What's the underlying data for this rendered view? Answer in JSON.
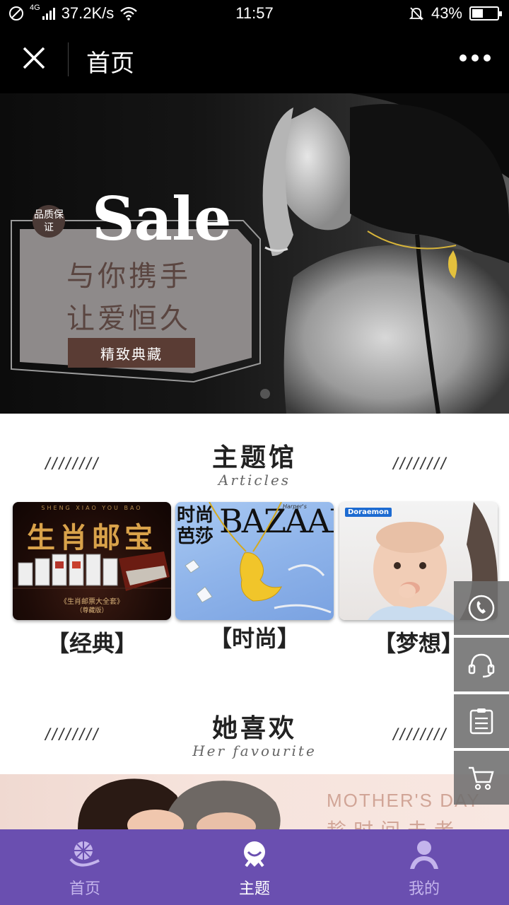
{
  "status_bar": {
    "network": "4G",
    "speed": "37.2K/s",
    "time": "11:57",
    "battery": "43%",
    "battery_level": 0.43
  },
  "header": {
    "title": "首页",
    "close_icon": "close-icon",
    "more_icon": "more-icon"
  },
  "banner": {
    "sale_text": "Sale",
    "badge_text": "品质保证",
    "line1": "与你携手",
    "line2": "让爱恒久",
    "button_label": "精致典藏"
  },
  "section1": {
    "title": "主题馆",
    "subtitle": "Articles",
    "slashes": "////////",
    "cards": [
      {
        "caption": "【经典】",
        "image_top": "SHENG XIAO YOU BAO",
        "image_title": "生肖邮宝",
        "image_sub": "《生肖邮票大全套》",
        "image_sub2": "（尊藏版）"
      },
      {
        "caption": "【时尚】",
        "image_title": "BAZAAR",
        "image_cn": "时尚芭莎",
        "image_small": "Harper's"
      },
      {
        "caption": "【梦想】",
        "image_tag": "Doraemon"
      }
    ]
  },
  "section2": {
    "title": "她喜欢",
    "subtitle": "Her favourite",
    "slashes": "////////",
    "banner_text": "MOTHER'S DAY",
    "banner_cn": "趁时间未老"
  },
  "side_buttons": [
    "phone-icon",
    "headset-icon",
    "clipboard-icon",
    "cart-icon"
  ],
  "tabbar": {
    "tabs": [
      {
        "label": "首页",
        "icon": "home-swirl-icon",
        "active": false
      },
      {
        "label": "主题",
        "icon": "theme-icon",
        "active": true
      },
      {
        "label": "我的",
        "icon": "user-icon",
        "active": false
      }
    ]
  },
  "colors": {
    "tabbar": "#6a4fb0",
    "promo_button": "#5a3c34"
  }
}
